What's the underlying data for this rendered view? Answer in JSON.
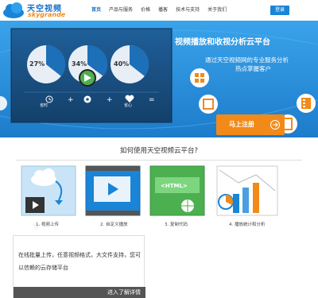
{
  "header": {
    "logo_cn": "天空视频",
    "logo_en": "skygrande",
    "nav": [
      "首页",
      "产品与服务",
      "价格",
      "播客",
      "技术与支持",
      "关于我们"
    ],
    "login": "登录"
  },
  "hero": {
    "title": "视频播放和收视分析云平台",
    "sub1": "通过天空视频网的专业服务分析",
    "sub2": "热点掌握客户",
    "register": "马上注册",
    "stats": [
      {
        "value": "27%",
        "label": "省时"
      },
      {
        "value": "34%",
        "label": ""
      },
      {
        "value": "40%",
        "label": "省心"
      }
    ]
  },
  "how": {
    "title": "如何使用天空视频云平台?",
    "steps": [
      "1. 视频上传",
      "2. 自定义播放",
      "3. 复制代码",
      "4. 播放统计和分析"
    ],
    "html_tag": "<HTML>",
    "callout_text": "在线批量上传，任意视频格式，大文件支持，您可以信赖的云存储平台",
    "callout_link": "进入了解详情"
  },
  "colors": {
    "brand_blue": "#1a6fc4",
    "hero_blue": "#2a8fd9",
    "accent_orange": "#f28a1a"
  }
}
